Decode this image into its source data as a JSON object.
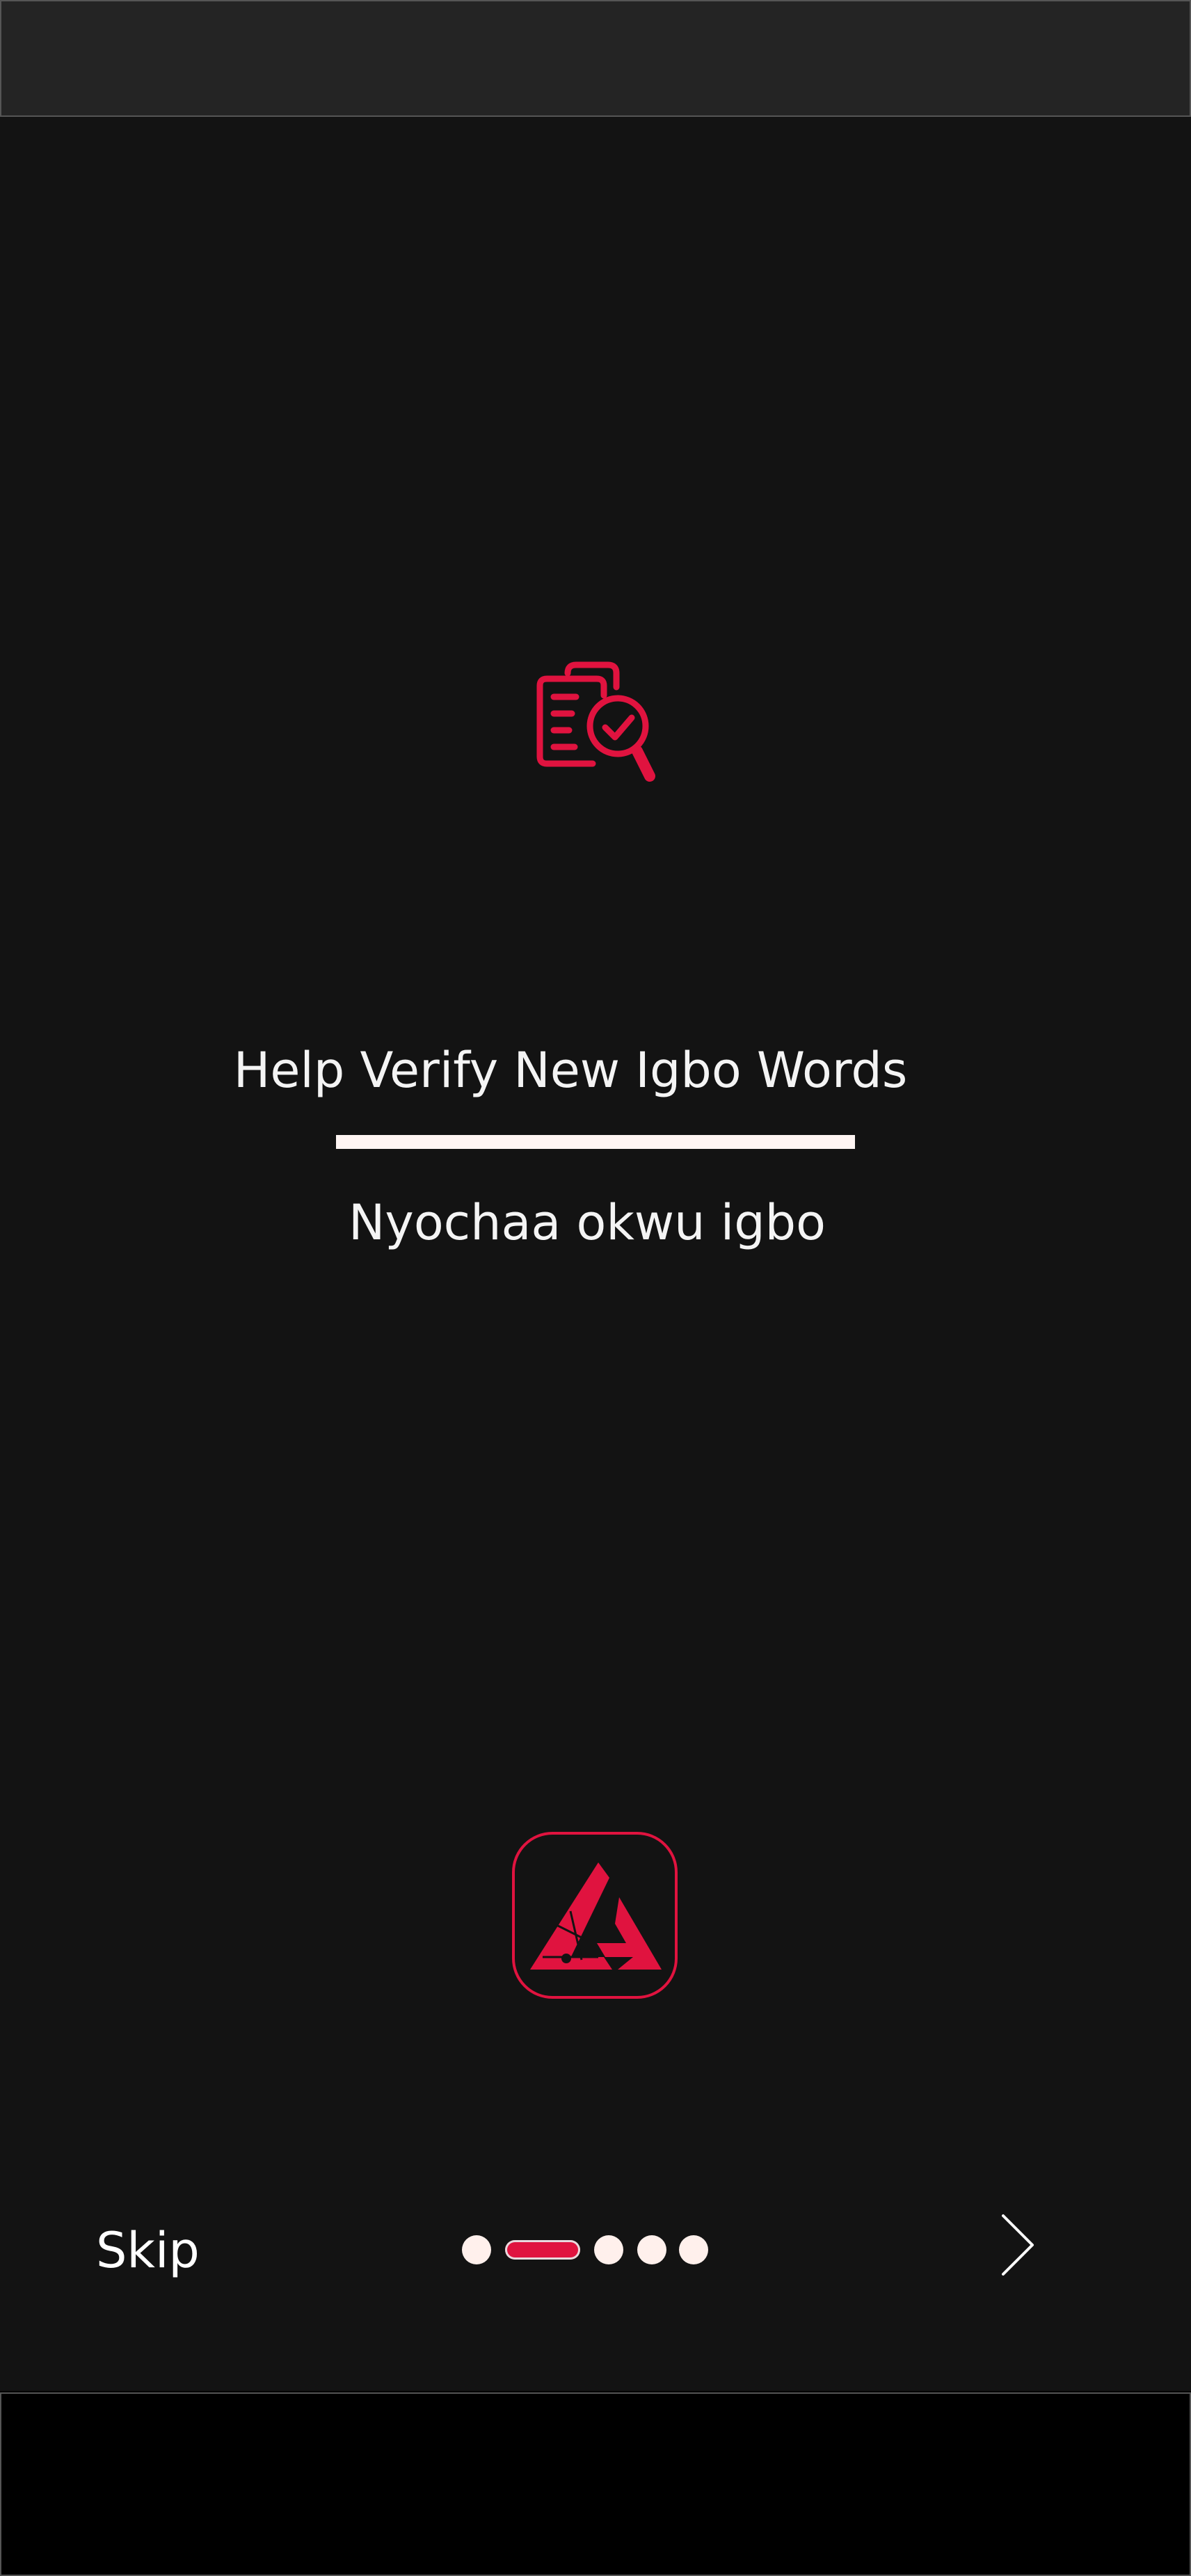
{
  "colors": {
    "accent": "#e0133f",
    "background": "#131313",
    "status_bar": "#242424",
    "text": "#f4f4f4",
    "dot_inactive": "#fff0ec"
  },
  "onboarding": {
    "hero_icon": "document-search-check-icon",
    "title": "Help Verify New Igbo Words",
    "subtitle": "Nyochaa okwu igbo",
    "app_logo_icon": "igbo-api-logo-icon"
  },
  "footer": {
    "skip_label": "Skip",
    "next_icon": "chevron-right-icon",
    "pager": {
      "total_pages": 5,
      "current_page": 2
    }
  }
}
